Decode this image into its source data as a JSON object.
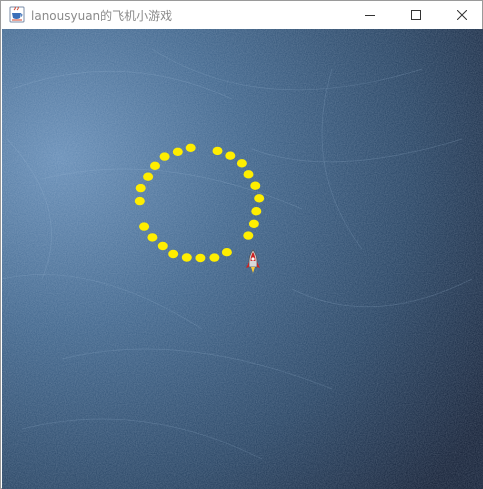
{
  "window": {
    "title": "lanousyuan的飞机小游戏",
    "app_icon": "java-cup-icon",
    "controls": {
      "minimize_icon": "minimize-icon",
      "maximize_icon": "maximize-icon",
      "close_icon": "close-icon"
    }
  },
  "game": {
    "background": "dark-blue-textured-space",
    "colors": {
      "bullet": "#ffee00",
      "background_light": "#5f85ad",
      "background_dark": "#1b2a40",
      "plane_body": "#cc2222"
    },
    "player_plane": "rocket-plane-icon",
    "bullets_count": 27
  }
}
